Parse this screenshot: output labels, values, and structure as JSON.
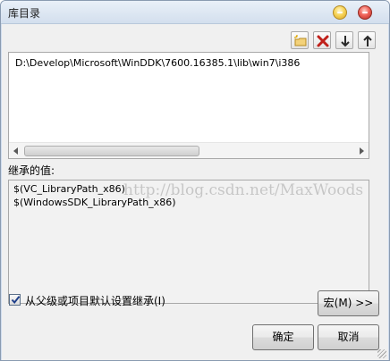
{
  "window": {
    "title": "库目录"
  },
  "toolbar": {
    "new_line_icon": "new-line-icon",
    "delete_icon": "delete-icon",
    "move_down_icon": "arrow-down-icon",
    "move_up_icon": "arrow-up-icon"
  },
  "paths": [
    "D:\\Develop\\Microsoft\\WinDDK\\7600.16385.1\\lib\\win7\\i386"
  ],
  "inherited": {
    "label": "继承的值:",
    "values": [
      "$(VC_LibraryPath_x86)",
      "$(WindowsSDK_LibraryPath_x86)"
    ]
  },
  "options": {
    "inherit_checkbox_label": "从父级或项目默认设置继承(I)",
    "inherit_checked": true
  },
  "buttons": {
    "macro": "宏(M) >>",
    "ok": "确定",
    "cancel": "取消"
  },
  "watermark": "http://blog.csdn.net/MaxWoods",
  "colors": {
    "title_bar": "#d3dfee",
    "client": "#f0f0f0",
    "delete_red": "#c0201a",
    "arrow_dark": "#2a2a2a"
  }
}
